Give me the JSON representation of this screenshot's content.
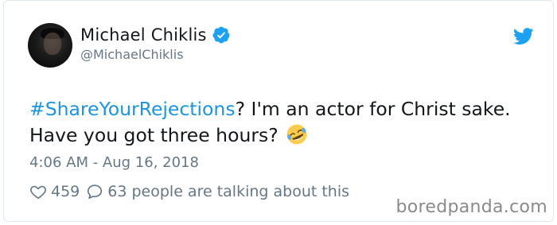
{
  "tweet": {
    "author": {
      "name": "Michael Chiklis",
      "handle": "@MichaelChiklis",
      "verified": true
    },
    "text": {
      "hashtag": "#ShareYourRejections",
      "body_line1": "? I'm an actor for Christ sake.",
      "body_line2": "Have you got three hours?",
      "emoji": "rolling-on-the-floor-laughing-emoji"
    },
    "timestamp": "4:06 AM - Aug 16, 2018",
    "likes": "459",
    "replies": "63 people are talking about this"
  },
  "icons": {
    "verified": "verified-badge-icon",
    "bird": "twitter-bird-icon",
    "heart": "heart-icon",
    "reply": "reply-bubble-icon"
  },
  "colors": {
    "link": "#1b95e0",
    "text": "#14171a",
    "secondary": "#657786",
    "twitter_blue": "#1da1f2"
  },
  "watermark": "boredpanda.com"
}
